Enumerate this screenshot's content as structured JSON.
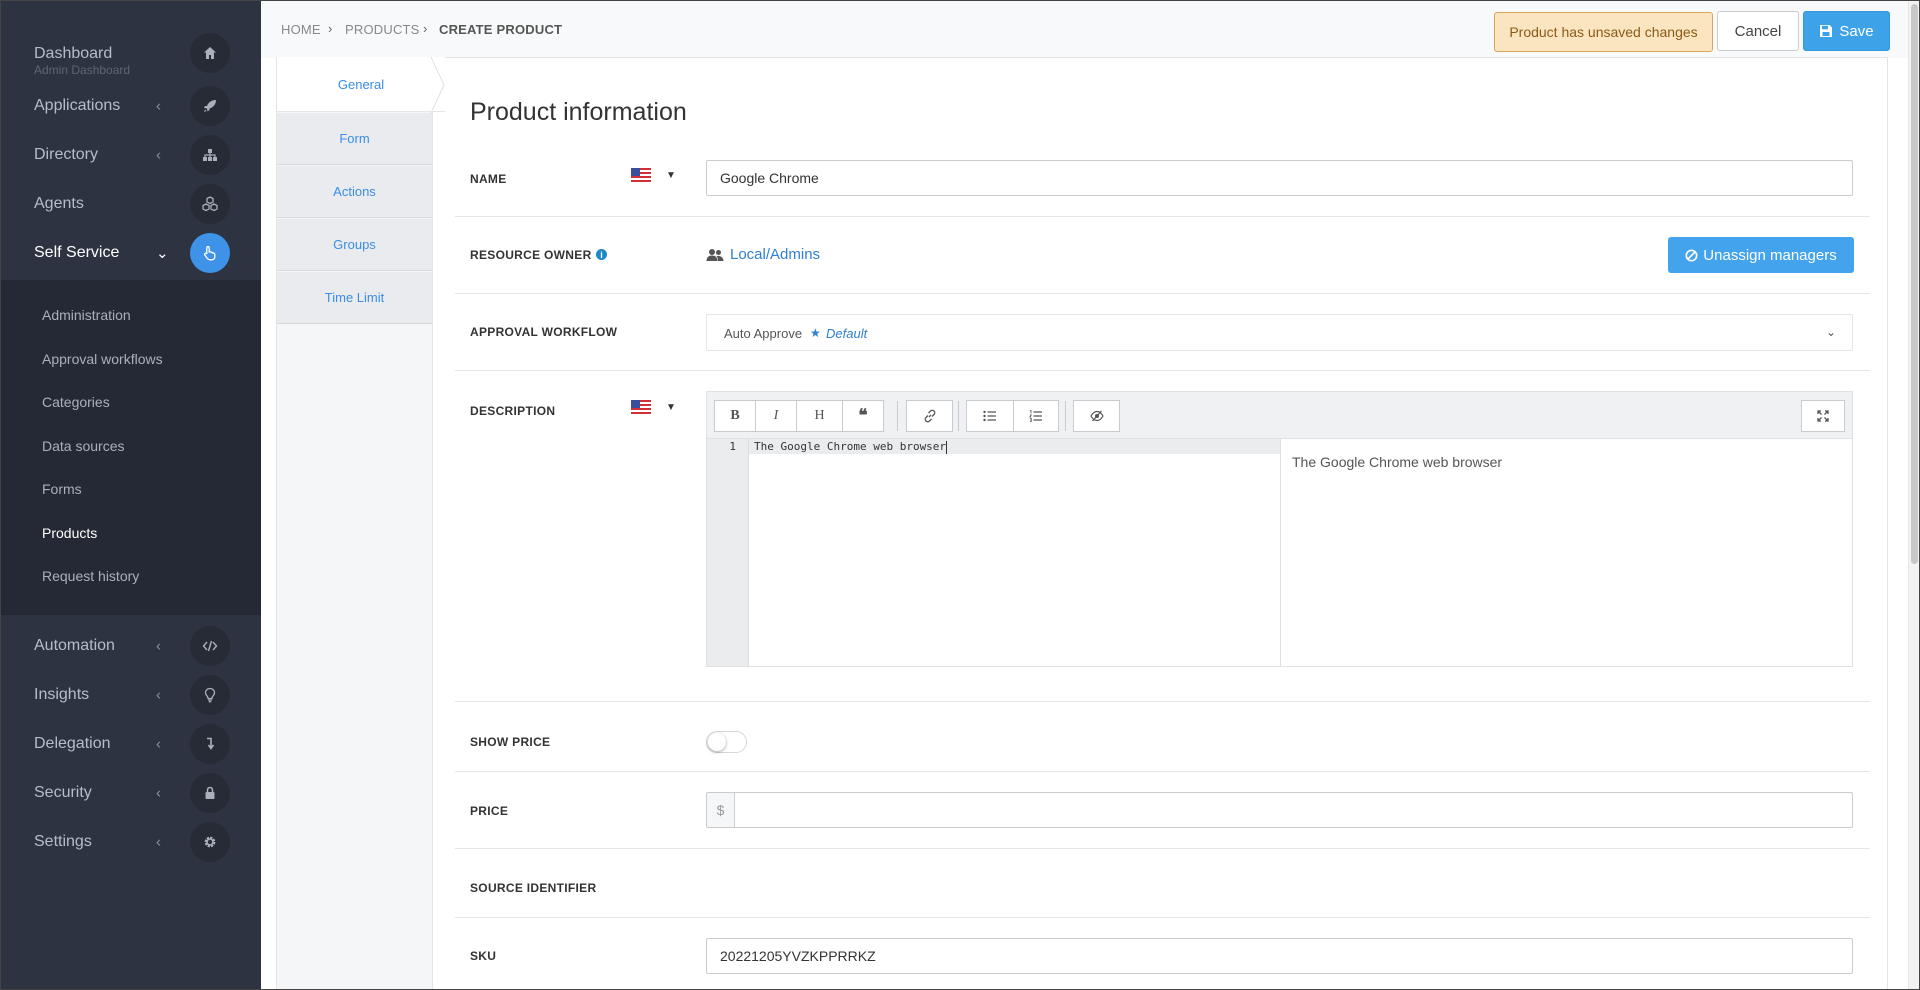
{
  "sidebar": {
    "items": [
      {
        "label": "Dashboard",
        "sub": "Admin Dashboard",
        "icon": "home-icon"
      },
      {
        "label": "Applications",
        "icon": "rocket-icon"
      },
      {
        "label": "Directory",
        "icon": "sitemap-icon"
      },
      {
        "label": "Agents",
        "icon": "cubes-icon"
      },
      {
        "label": "Self Service",
        "icon": "hand-pointer-icon"
      },
      {
        "label": "Automation",
        "icon": "code-icon"
      },
      {
        "label": "Insights",
        "icon": "lightbulb-icon"
      },
      {
        "label": "Delegation",
        "icon": "level-down-icon"
      },
      {
        "label": "Security",
        "icon": "lock-icon"
      },
      {
        "label": "Settings",
        "icon": "gear-icon"
      }
    ],
    "subitems": [
      "Administration",
      "Approval workflows",
      "Categories",
      "Data sources",
      "Forms",
      "Products",
      "Request history"
    ],
    "active_subitem": "Products"
  },
  "breadcrumb": [
    "HOME",
    "PRODUCTS",
    "CREATE PRODUCT"
  ],
  "header": {
    "unsaved": "Product has unsaved changes",
    "cancel": "Cancel",
    "save": "Save"
  },
  "tabs": [
    "General",
    "Form",
    "Actions",
    "Groups",
    "Time Limit"
  ],
  "form": {
    "title": "Product information",
    "name_label": "NAME",
    "name_value": "Google Chrome",
    "owner_label": "RESOURCE OWNER",
    "owner_value": "Local/Admins",
    "unassign": "Unassign managers",
    "workflow_label": "APPROVAL WORKFLOW",
    "workflow_value": "Auto Approve",
    "workflow_tag": "Default",
    "description_label": "DESCRIPTION",
    "description_line_no": "1",
    "description_value": "The Google Chrome web browser",
    "description_preview": "The Google Chrome web browser",
    "toolbar_bold": "B",
    "toolbar_italic": "I",
    "toolbar_heading": "H",
    "show_price_label": "SHOW PRICE",
    "show_price": false,
    "price_label": "PRICE",
    "price_currency": "$",
    "price_value": "",
    "source_label": "SOURCE IDENTIFIER",
    "sku_label": "SKU",
    "sku_value": "20221205YVZKPPRRKZ"
  },
  "colors": {
    "sidebar_bg": "#2d3340",
    "accent": "#3e92e8",
    "warning_bg": "#fbe5c1",
    "link": "#2f80d0"
  }
}
